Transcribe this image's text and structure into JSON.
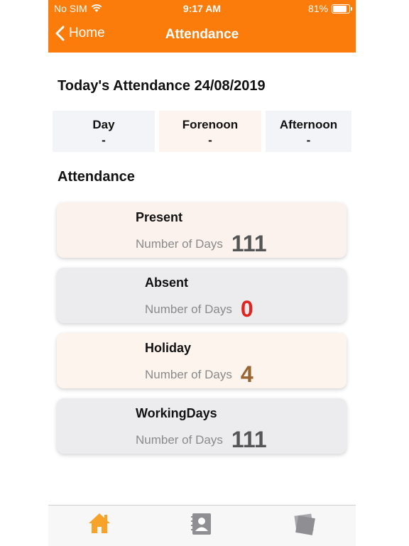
{
  "status_bar": {
    "carrier": "No SIM",
    "time": "9:17 AM",
    "battery": "81%",
    "battery_level": 0.81
  },
  "nav": {
    "back_label": "Home",
    "title": "Attendance"
  },
  "today": {
    "heading": "Today's Attendance 24/08/2019",
    "segments": [
      {
        "label": "Day",
        "value": "-"
      },
      {
        "label": "Forenoon",
        "value": "-"
      },
      {
        "label": "Afternoon",
        "value": "-"
      }
    ]
  },
  "section_title": "Attendance",
  "cards": [
    {
      "title": "Present",
      "label": "Number of Days",
      "value": "111",
      "color": "#555555"
    },
    {
      "title": "Absent",
      "label": "Number of Days",
      "value": "0",
      "color": "#e0241f"
    },
    {
      "title": "Holiday",
      "label": "Number of Days",
      "value": "4",
      "color": "#9a6531"
    },
    {
      "title": "WorkingDays",
      "label": "Number of Days",
      "value": "111",
      "color": "#555555"
    }
  ],
  "tabbar": {
    "icons": [
      "home-icon",
      "contacts-icon",
      "notes-icon"
    ],
    "active_color": "#f7a229",
    "inactive_color": "#8e8e93"
  },
  "colors": {
    "accent": "#fb7c0a"
  }
}
